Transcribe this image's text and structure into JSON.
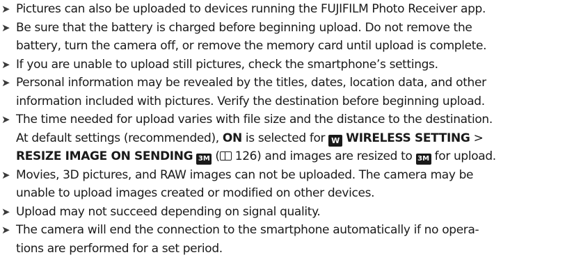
{
  "bullet_icon": "arrow-bullet-icon",
  "notes": [
    {
      "lines": [
        "Pictures can also be uploaded to devices running the FUJIFILM Photo Receiver app."
      ]
    },
    {
      "lines": [
        "Be sure that the battery is charged before beginning upload.  Do not remove the",
        "battery, turn the camera off, or remove the memory card until upload is complete."
      ]
    },
    {
      "lines": [
        "If you are unable to upload still pictures, check the smartphone’s settings."
      ]
    },
    {
      "lines": [
        "Personal information may be revealed by the titles, dates, location data, and other",
        "information included with pictures. Verify the destination before beginning upload."
      ]
    },
    {
      "lines": [
        "The time needed for upload varies with file size and the distance to the destination.",
        "At default settings (recommended), "
      ],
      "on_label": "ON",
      "selected_for": " is selected for ",
      "wireless_icon_text": "W",
      "wireless_setting": "WIRELESS SETTING",
      "separator": " >",
      "resize_label": "RESIZE IMAGE ON SENDING",
      "size_icon_text": "3M",
      "page_ref_open": " (",
      "page_ref": " 126",
      "page_ref_close": ")",
      "resize_tail": " and images are resized to ",
      "resize_tail_end": " for upload."
    },
    {
      "lines": [
        "Movies, 3D pictures, and RAW images can not be uploaded.  The camera may be",
        "unable to upload images created or modified on other devices."
      ]
    },
    {
      "lines": [
        "Upload may not succeed depending on signal quality."
      ]
    },
    {
      "lines": [
        "The camera will end the connection to the smartphone automatically if no opera-",
        "tions are performed for a set period."
      ]
    }
  ]
}
